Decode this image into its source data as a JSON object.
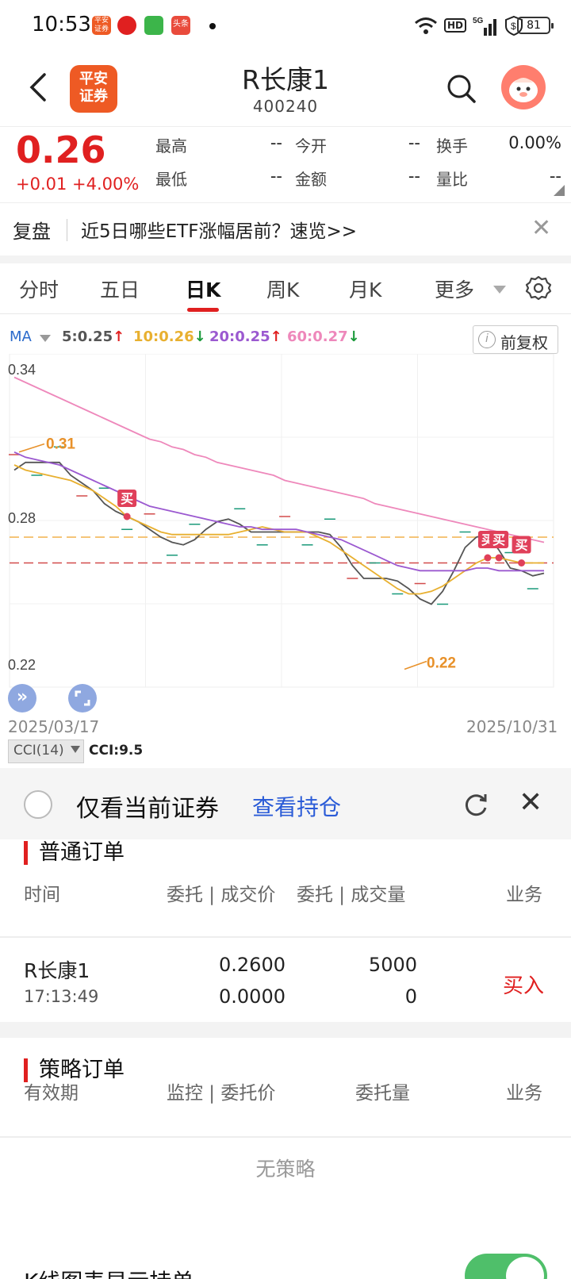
{
  "status_bar": {
    "time": "10:53",
    "battery": "81",
    "network": "5G",
    "hd": "HD",
    "notifications": [
      "平安证券",
      "拼多多",
      "微信",
      "头条"
    ]
  },
  "header": {
    "stock_name": "R长康1",
    "stock_code": "400240",
    "logo_text": "平安证券"
  },
  "quote": {
    "price": "0.26",
    "change": "+0.01",
    "change_pct": "+4.00%",
    "labels": {
      "high": "最高",
      "low": "最低",
      "open": "今开",
      "amount": "金额",
      "turnover": "换手",
      "volume_ratio": "量比"
    },
    "values": {
      "high": "--",
      "low": "--",
      "open": "--",
      "amount": "--",
      "turnover": "0.00%",
      "volume_ratio": "--"
    }
  },
  "banner": {
    "tag": "复盘",
    "text": "近5日哪些ETF涨幅居前？速览>>"
  },
  "tabs": [
    "分时",
    "五日",
    "日K",
    "周K",
    "月K",
    "更多"
  ],
  "active_tab": "日K",
  "ma": {
    "label": "MA",
    "items": [
      {
        "text": "5:0.25",
        "arrow": "↑",
        "color": "#555555",
        "arrow_color": "#e02020"
      },
      {
        "text": "10:0.26",
        "arrow": "↓",
        "color": "#e8b030",
        "arrow_color": "#1a9a3a"
      },
      {
        "text": "20:0.25",
        "arrow": "↑",
        "color": "#9b59d0",
        "arrow_color": "#e02020"
      },
      {
        "text": "60:0.27",
        "arrow": "↓",
        "color": "#ee88bb",
        "arrow_color": "#1a9a3a"
      }
    ],
    "fq_label": "前复权"
  },
  "chart_data": {
    "type": "line",
    "y_ticks": [
      "0.34",
      "0.28",
      "0.22"
    ],
    "ylim": [
      0.22,
      0.34
    ],
    "x_start": "2025/03/17",
    "x_end": "2025/10/31",
    "series": [
      {
        "name": "5",
        "color": "#555555",
        "values": [
          0.298,
          0.301,
          0.301,
          0.301,
          0.301,
          0.296,
          0.293,
          0.29,
          0.285,
          0.282,
          0.28,
          0.278,
          0.275,
          0.272,
          0.27,
          0.269,
          0.271,
          0.275,
          0.278,
          0.279,
          0.277,
          0.274,
          0.274,
          0.274,
          0.274,
          0.274,
          0.274,
          0.274,
          0.273,
          0.268,
          0.261,
          0.256,
          0.256,
          0.256,
          0.255,
          0.252,
          0.248,
          0.246,
          0.251,
          0.259,
          0.268,
          0.272,
          0.273,
          0.267,
          0.26,
          0.259,
          0.257,
          0.258
        ]
      },
      {
        "name": "10",
        "color": "#e8b030",
        "values": [
          0.3,
          0.298,
          0.297,
          0.296,
          0.295,
          0.294,
          0.292,
          0.29,
          0.287,
          0.284,
          0.28,
          0.278,
          0.276,
          0.274,
          0.273,
          0.273,
          0.273,
          0.273,
          0.273,
          0.273,
          0.274,
          0.275,
          0.276,
          0.275,
          0.274,
          0.274,
          0.274,
          0.272,
          0.27,
          0.267,
          0.264,
          0.261,
          0.258,
          0.255,
          0.252,
          0.25,
          0.25,
          0.251,
          0.253,
          0.256,
          0.259,
          0.262,
          0.264,
          0.264,
          0.263,
          0.262,
          0.262,
          0.262
        ]
      },
      {
        "name": "20",
        "color": "#9b59d0",
        "values": [
          0.305,
          0.303,
          0.302,
          0.301,
          0.3,
          0.298,
          0.296,
          0.294,
          0.292,
          0.29,
          0.288,
          0.286,
          0.284,
          0.283,
          0.282,
          0.281,
          0.28,
          0.279,
          0.278,
          0.277,
          0.276,
          0.276,
          0.275,
          0.275,
          0.275,
          0.275,
          0.274,
          0.273,
          0.272,
          0.271,
          0.269,
          0.267,
          0.265,
          0.263,
          0.261,
          0.26,
          0.259,
          0.259,
          0.259,
          0.259,
          0.259,
          0.26,
          0.26,
          0.259,
          0.259,
          0.259,
          0.259,
          0.259
        ]
      },
      {
        "name": "60",
        "color": "#ee88bb",
        "values": [
          0.334,
          0.332,
          0.33,
          0.328,
          0.326,
          0.324,
          0.322,
          0.32,
          0.318,
          0.316,
          0.314,
          0.312,
          0.31,
          0.309,
          0.307,
          0.306,
          0.304,
          0.303,
          0.301,
          0.3,
          0.299,
          0.298,
          0.297,
          0.296,
          0.294,
          0.293,
          0.292,
          0.291,
          0.29,
          0.289,
          0.288,
          0.287,
          0.285,
          0.284,
          0.283,
          0.282,
          0.281,
          0.28,
          0.279,
          0.278,
          0.277,
          0.276,
          0.275,
          0.274,
          0.273,
          0.272,
          0.271,
          0.27
        ]
      }
    ],
    "hlines": [
      {
        "value": 0.272,
        "color": "#f2b24d"
      },
      {
        "value": 0.262,
        "color": "#d24b4b"
      }
    ],
    "annotations": [
      {
        "text": "0.31",
        "value": 0.31,
        "color": "#e8912a"
      },
      {
        "text": "0.22",
        "value": 0.222,
        "color": "#e8912a"
      }
    ],
    "buy_marks": [
      {
        "label": "买",
        "index": 10
      },
      {
        "label": "买",
        "index": 42
      },
      {
        "label": "买",
        "index": 43
      },
      {
        "label": "买",
        "index": 45
      }
    ]
  },
  "cci": {
    "label": "CCI(14)",
    "value": "CCI:9.5"
  },
  "orders": {
    "only_current": "仅看当前证券",
    "view_positions": "查看持仓",
    "normal_title": "普通订单",
    "normal_headers": [
      "时间",
      "委托 | 成交价",
      "委托 | 成交量",
      "业务"
    ],
    "normal_rows": [
      {
        "name": "R长康1",
        "time": "17:13:49",
        "order_price": "0.2600",
        "deal_price": "0.0000",
        "order_qty": "5000",
        "deal_qty": "0",
        "action": "买入"
      }
    ],
    "strategy_title": "策略订单",
    "strategy_headers": [
      "有效期",
      "监控 | 委托价",
      "委托量",
      "业务"
    ],
    "strategy_empty": "无策略",
    "kline_toggle_label": "K线图表显示持单"
  },
  "colors": {
    "up": "#e02020",
    "down": "#1a9a3a",
    "link": "#2a5bd7",
    "brand": "#ee5a24"
  }
}
